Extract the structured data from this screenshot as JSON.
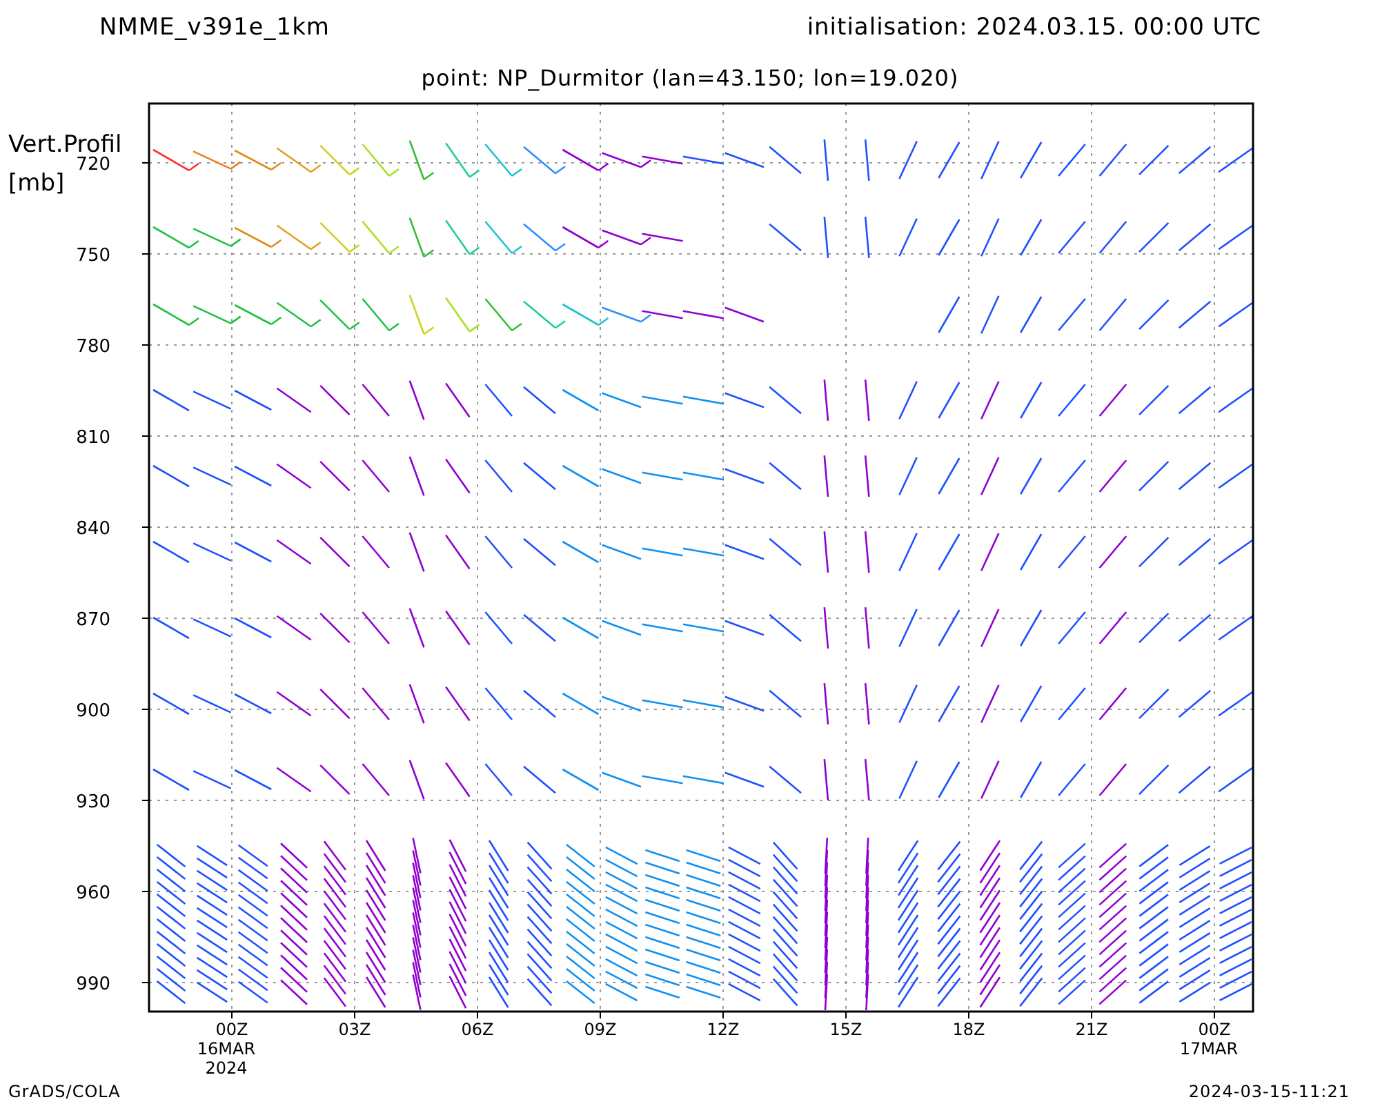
{
  "header": {
    "model": "NMME_v391e_1km",
    "initialisation": "initialisation: 2024.03.15. 00:00 UTC"
  },
  "subtitle": "point: NP_Durmitor (lan=43.150; lon=19.020)",
  "plot": {
    "ylabel_lines": [
      "Vert.Profil",
      "[mb]"
    ],
    "yticks": [
      "720",
      "750",
      "780",
      "810",
      "840",
      "870",
      "900",
      "930",
      "960",
      "990"
    ],
    "xticks": [
      {
        "label": "00Z",
        "sub": [
          "16MAR",
          "2024"
        ]
      },
      {
        "label": "03Z"
      },
      {
        "label": "06Z"
      },
      {
        "label": "09Z"
      },
      {
        "label": "12Z"
      },
      {
        "label": "15Z"
      },
      {
        "label": "18Z"
      },
      {
        "label": "21Z"
      },
      {
        "label": "00Z",
        "sub": [
          "17MAR"
        ]
      }
    ]
  },
  "footer": {
    "left": "GrADS/COLA",
    "right": "2024-03-15-11:21"
  }
}
